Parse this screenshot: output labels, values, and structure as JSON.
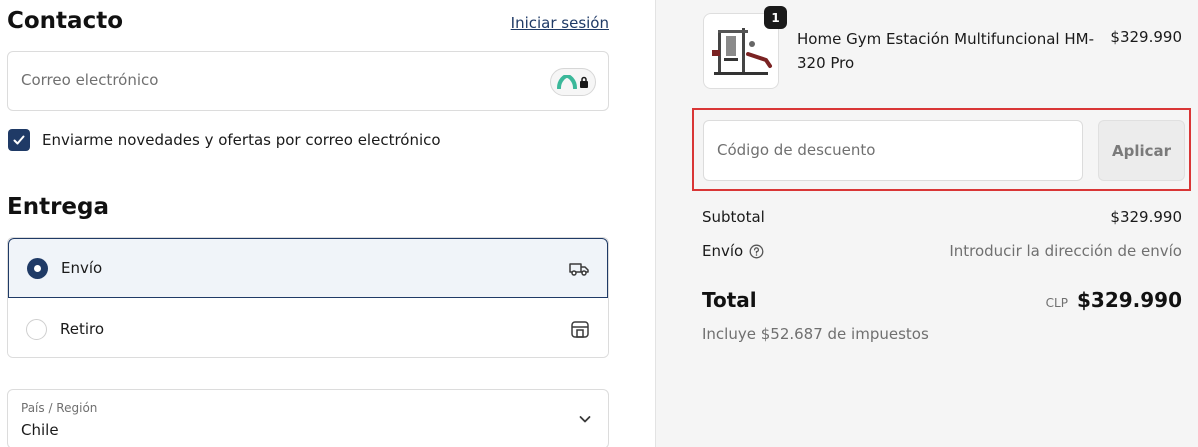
{
  "contact": {
    "heading": "Contacto",
    "login_link": "Iniciar sesión",
    "email_placeholder": "Correo electrónico",
    "newsletter_label": "Enviarme novedades y ofertas por correo electrónico",
    "newsletter_checked": true
  },
  "delivery": {
    "heading": "Entrega",
    "options": [
      {
        "label": "Envío",
        "selected": true,
        "icon": "truck-icon"
      },
      {
        "label": "Retiro",
        "selected": false,
        "icon": "store-icon"
      }
    ],
    "country_label": "País / Región",
    "country_value": "Chile"
  },
  "order": {
    "product": {
      "name": "Home Gym Estación Multifuncional HM-320 Pro",
      "price": "$329.990",
      "quantity": "1"
    },
    "discount": {
      "placeholder": "Código de descuento",
      "apply_label": "Aplicar"
    },
    "subtotal_label": "Subtotal",
    "subtotal_value": "$329.990",
    "shipping_label": "Envío",
    "shipping_value": "Introducir la dirección de envío",
    "total_label": "Total",
    "currency": "CLP",
    "total_value": "$329.990",
    "taxes_note": "Incluye $52.687 de impuestos"
  },
  "colors": {
    "accent": "#1f3a66",
    "highlight_border": "#d93636",
    "summary_bg": "#f5f5f5"
  }
}
